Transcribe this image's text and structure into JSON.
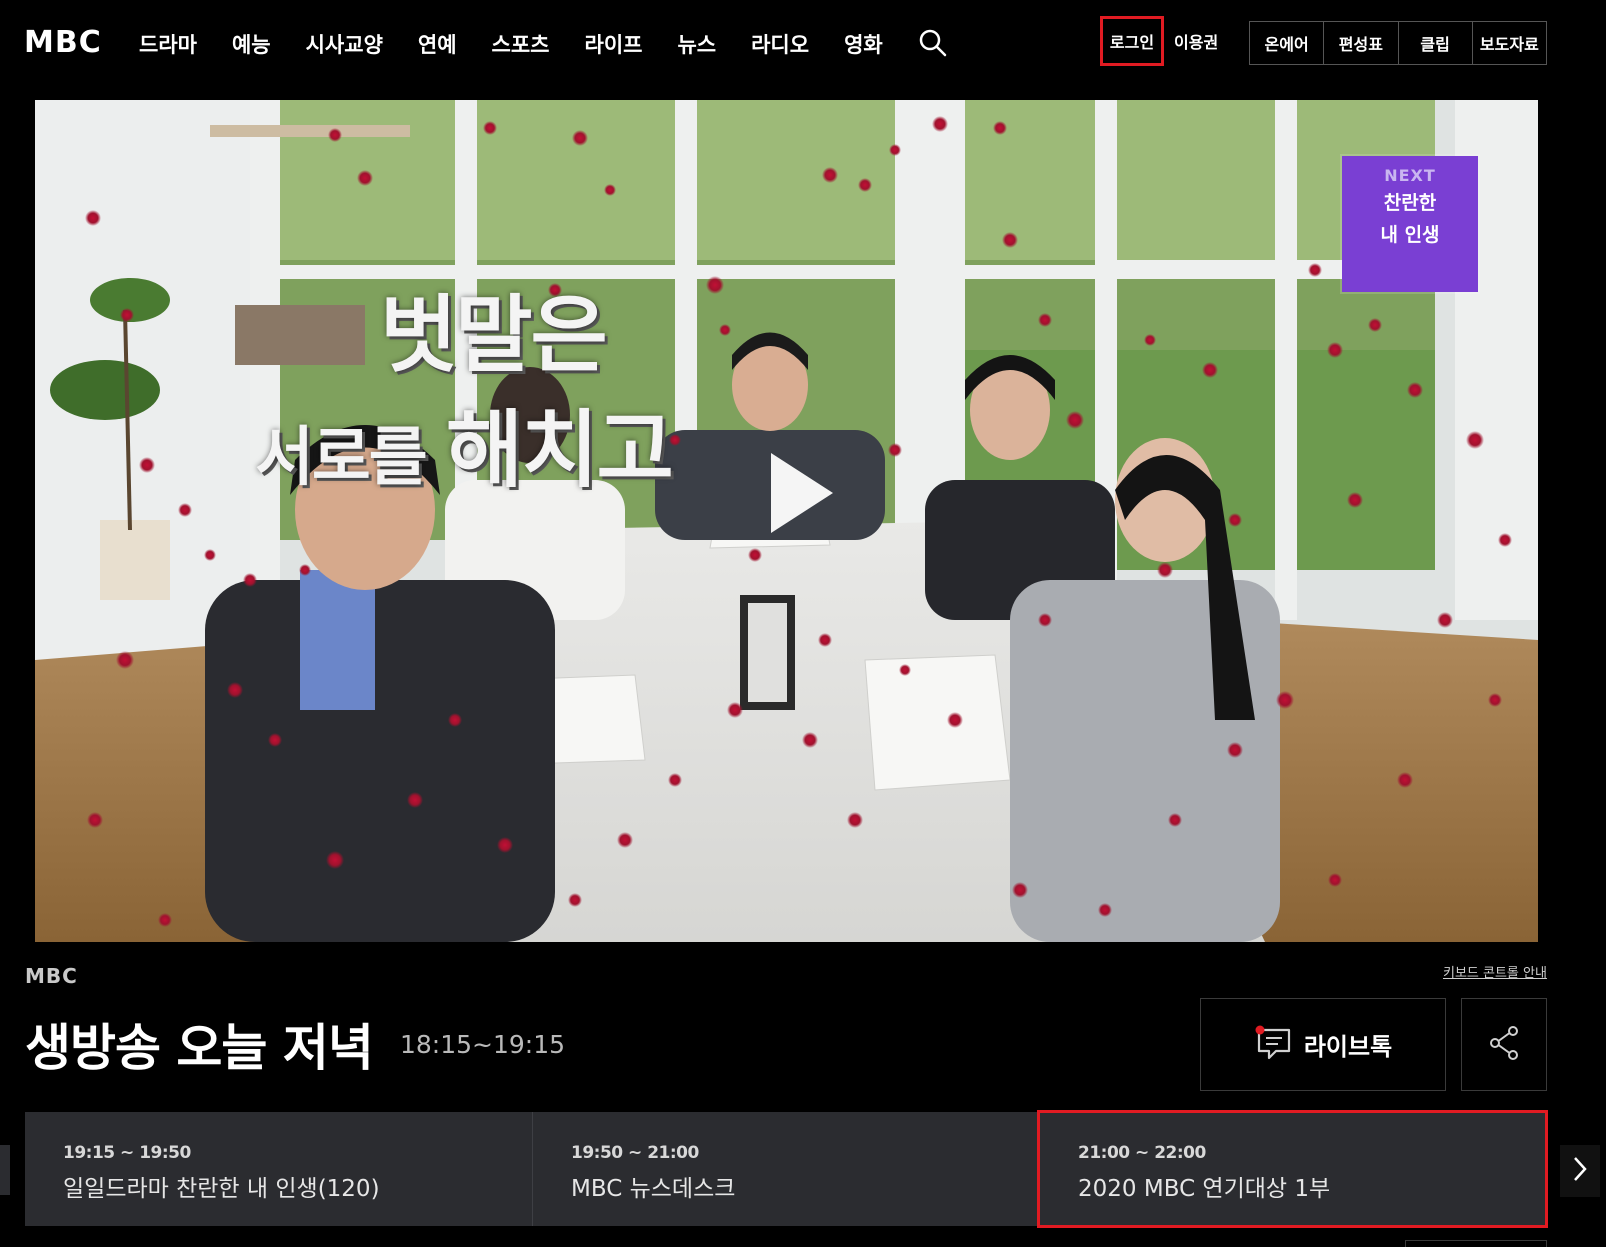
{
  "header": {
    "logo": "MBC",
    "nav": [
      "드라마",
      "예능",
      "시사교양",
      "연예",
      "스포츠",
      "라이프",
      "뉴스",
      "라디오",
      "영화"
    ],
    "login": "로그인",
    "ticket": "이용권",
    "quick": [
      "온에어",
      "편성표",
      "클립",
      "보도자료"
    ]
  },
  "player": {
    "caption_line1": "벗말은",
    "caption_line2_small": "서로를 ",
    "caption_line2_big": "해치고",
    "next_label": "NEXT",
    "next_title_1": "찬란한",
    "next_title_2": "내 인생"
  },
  "info": {
    "channel": "MBC",
    "keyboard_guide": "키보드 콘트롤 안내",
    "title": "생방송 오늘 저녁",
    "time": "18:15~19:15",
    "livetalk": "라이브톡"
  },
  "schedule": [
    {
      "time": "19:15 ~ 19:50",
      "name": "일일드라마 찬란한 내 인생(120)"
    },
    {
      "time": "19:50 ~ 21:00",
      "name": "MBC 뉴스데스크"
    },
    {
      "time": "21:00 ~ 22:00",
      "name": "2020 MBC 연기대상 1부"
    }
  ],
  "colors": {
    "highlight_red": "#e11b22",
    "badge_purple": "#7a3fd3",
    "schedule_bg": "#2b2c30"
  }
}
